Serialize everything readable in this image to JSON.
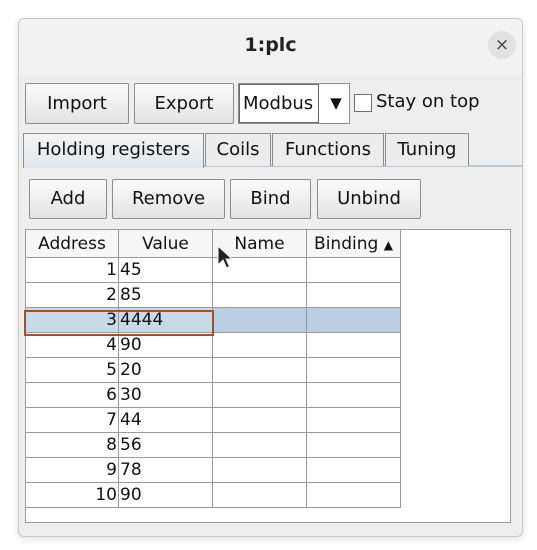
{
  "window": {
    "title": "1:plc",
    "close_glyph": "×"
  },
  "toolbar": {
    "import_label": "Import",
    "export_label": "Export",
    "protocol_value": "Modbus",
    "protocol_arrow_glyph": "▼",
    "stay_on_top_label": "Stay on top",
    "stay_on_top_checked": false
  },
  "tabs": [
    {
      "label": "Holding registers",
      "active": true
    },
    {
      "label": "Coils",
      "active": false
    },
    {
      "label": "Functions",
      "active": false
    },
    {
      "label": "Tuning",
      "active": false
    }
  ],
  "actions": {
    "add_label": "Add",
    "remove_label": "Remove",
    "bind_label": "Bind",
    "unbind_label": "Unbind"
  },
  "table": {
    "columns": [
      "Address",
      "Value",
      "Name",
      "Binding"
    ],
    "sort_indicator": "▲",
    "sort_column": "Binding",
    "selected_row": 3,
    "rows": [
      {
        "address": "1",
        "value": "45",
        "name": "",
        "binding": ""
      },
      {
        "address": "2",
        "value": "85",
        "name": "",
        "binding": ""
      },
      {
        "address": "3",
        "value": "4444",
        "name": "",
        "binding": ""
      },
      {
        "address": "4",
        "value": "90",
        "name": "",
        "binding": ""
      },
      {
        "address": "5",
        "value": "20",
        "name": "",
        "binding": ""
      },
      {
        "address": "6",
        "value": "30",
        "name": "",
        "binding": ""
      },
      {
        "address": "7",
        "value": "44",
        "name": "",
        "binding": ""
      },
      {
        "address": "8",
        "value": "56",
        "name": "",
        "binding": ""
      },
      {
        "address": "9",
        "value": "78",
        "name": "",
        "binding": ""
      },
      {
        "address": "10",
        "value": "90",
        "name": "",
        "binding": ""
      }
    ]
  },
  "colors": {
    "selection": "#b8cfe4",
    "selection_border": "#a0522d",
    "tab_line": "#b8c8d6"
  }
}
